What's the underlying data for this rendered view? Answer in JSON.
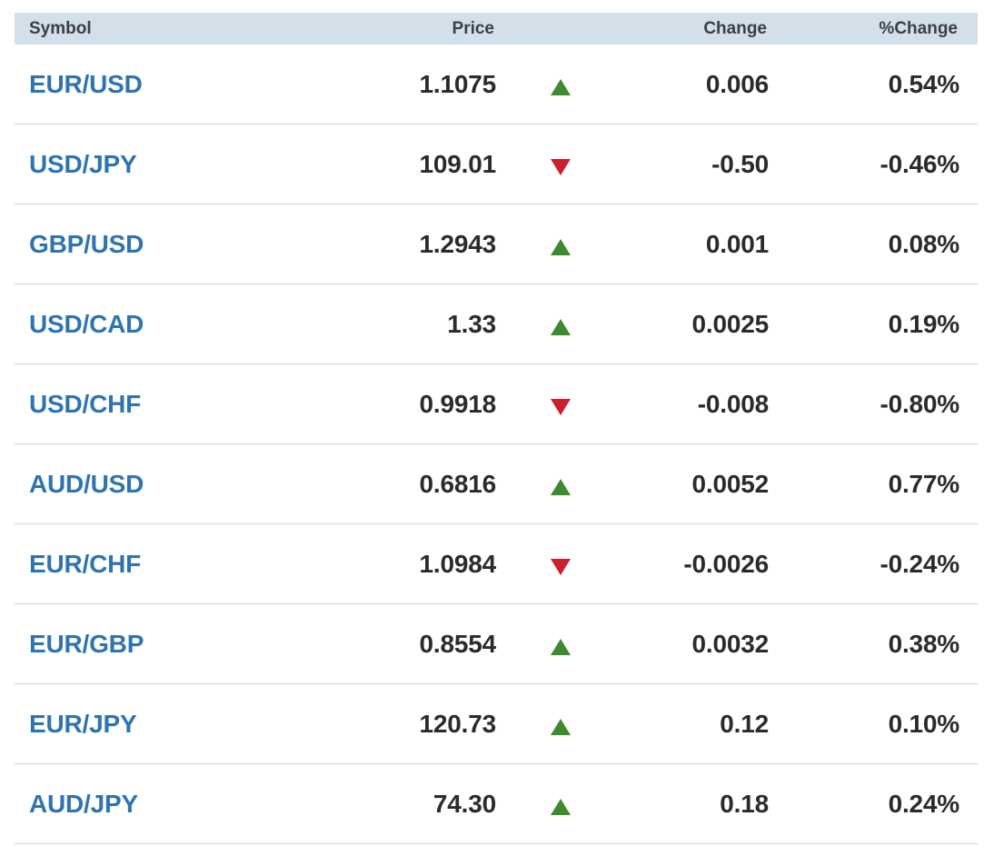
{
  "header": {
    "symbol": "Symbol",
    "price": "Price",
    "change": "Change",
    "pct_change": "%Change"
  },
  "rows": [
    {
      "symbol": "EUR/USD",
      "price": "1.1075",
      "direction": "up",
      "change": "0.006",
      "pct_change": "0.54%"
    },
    {
      "symbol": "USD/JPY",
      "price": "109.01",
      "direction": "down",
      "change": "-0.50",
      "pct_change": "-0.46%"
    },
    {
      "symbol": "GBP/USD",
      "price": "1.2943",
      "direction": "up",
      "change": "0.001",
      "pct_change": "0.08%"
    },
    {
      "symbol": "USD/CAD",
      "price": "1.33",
      "direction": "up",
      "change": "0.0025",
      "pct_change": "0.19%"
    },
    {
      "symbol": "USD/CHF",
      "price": "0.9918",
      "direction": "down",
      "change": "-0.008",
      "pct_change": "-0.80%"
    },
    {
      "symbol": "AUD/USD",
      "price": "0.6816",
      "direction": "up",
      "change": "0.0052",
      "pct_change": "0.77%"
    },
    {
      "symbol": "EUR/CHF",
      "price": "1.0984",
      "direction": "down",
      "change": "-0.0026",
      "pct_change": "-0.24%"
    },
    {
      "symbol": "EUR/GBP",
      "price": "0.8554",
      "direction": "up",
      "change": "0.0032",
      "pct_change": "0.38%"
    },
    {
      "symbol": "EUR/JPY",
      "price": "120.73",
      "direction": "up",
      "change": "0.12",
      "pct_change": "0.10%"
    },
    {
      "symbol": "AUD/JPY",
      "price": "74.30",
      "direction": "up",
      "change": "0.18",
      "pct_change": "0.24%"
    }
  ],
  "colors": {
    "symbol_link": "#2f74b2",
    "up_arrow": "#3f8a2e",
    "down_arrow": "#cc1f2d",
    "header_bg": "#d3dfe9"
  },
  "icons": {
    "up": "triangle-up-icon",
    "down": "triangle-down-icon"
  }
}
